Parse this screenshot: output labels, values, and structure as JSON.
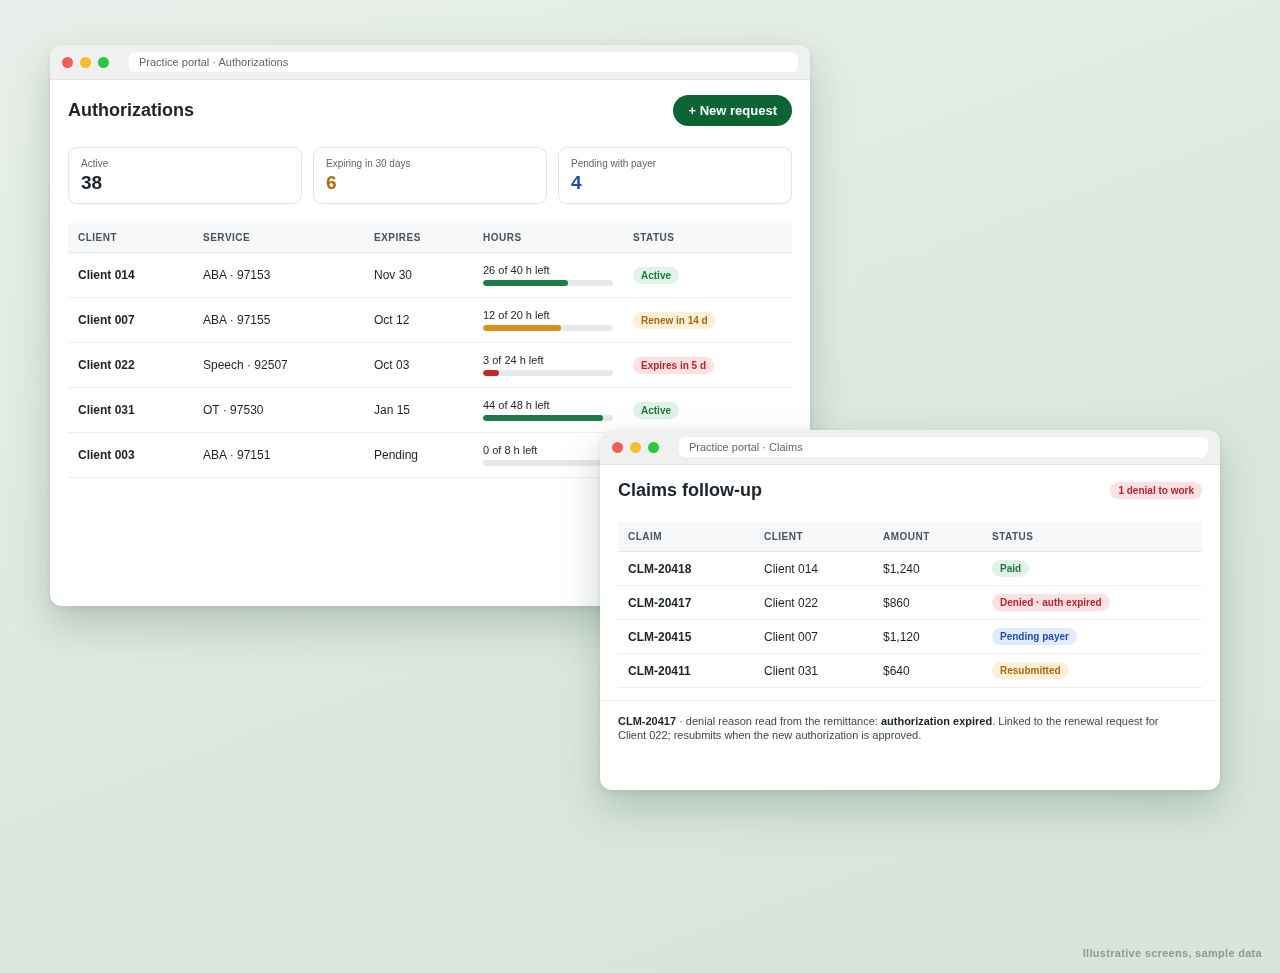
{
  "authorizations_window": {
    "title": "Practice portal · Authorizations",
    "heading": "Authorizations",
    "new_button": "+ New request",
    "stats": [
      {
        "label": "Active",
        "value": "38",
        "color": "#1b232b"
      },
      {
        "label": "Expiring in 30 days",
        "value": "6",
        "color": "#a86c0c"
      },
      {
        "label": "Pending with payer",
        "value": "4",
        "color": "#1f4fae"
      }
    ],
    "table": {
      "columns": [
        "CLIENT",
        "SERVICE",
        "EXPIRES",
        "HOURS",
        "STATUS"
      ],
      "rows": [
        {
          "client": "Client 014",
          "service": "ABA · 97153",
          "expires": "Nov 30",
          "hours": {
            "label": "26 of 40 h left",
            "level": 0.65,
            "kind": "ok"
          },
          "status": {
            "label": "Active",
            "kind": "ok"
          }
        },
        {
          "client": "Client 007",
          "service": "ABA · 97155",
          "expires": "Oct 12",
          "hours": {
            "label": "12 of 20 h left",
            "level": 0.6,
            "kind": "warn"
          },
          "status": {
            "label": "Renew in 14 d",
            "kind": "warn"
          }
        },
        {
          "client": "Client 022",
          "service": "Speech · 92507",
          "expires": "Oct 03",
          "hours": {
            "label": "3 of 24 h left",
            "level": 0.125,
            "kind": "bad"
          },
          "status": {
            "label": "Expires in 5 d",
            "kind": "bad"
          }
        },
        {
          "client": "Client 031",
          "service": "OT · 97530",
          "expires": "Jan 15",
          "hours": {
            "label": "44 of 48 h left",
            "level": 0.92,
            "kind": "ok"
          },
          "status": {
            "label": "Active",
            "kind": "ok"
          }
        },
        {
          "client": "Client 003",
          "service": "ABA · 97151",
          "expires": "Pending",
          "hours": {
            "label": "0 of 8 h left",
            "level": 0,
            "kind": "ok"
          }
        }
      ]
    }
  },
  "claims_window": {
    "title": "Practice portal · Claims",
    "heading": "Claims follow-up",
    "alert_badge": "1 denial to work",
    "table": {
      "columns": [
        "CLAIM",
        "CLIENT",
        "AMOUNT",
        "STATUS"
      ],
      "rows": [
        {
          "claim": "CLM-20418",
          "client": "Client 014",
          "amount": "$1,240",
          "status": {
            "label": "Paid",
            "kind": "ok"
          }
        },
        {
          "claim": "CLM-20417",
          "client": "Client 022",
          "amount": "$860",
          "status": {
            "label": "Denied · auth expired",
            "kind": "bad"
          }
        },
        {
          "claim": "CLM-20415",
          "client": "Client 007",
          "amount": "$1,120",
          "status": {
            "label": "Pending payer",
            "kind": "info"
          }
        },
        {
          "claim": "CLM-20411",
          "client": "Client 031",
          "amount": "$640",
          "status": {
            "label": "Resubmitted",
            "kind": "warn"
          }
        }
      ]
    },
    "note": "**CLM-20417** · denial reason read from the remittance: **authorization expired**. Linked to the renewal request for Client 022; resubmits when the new authorization is approved."
  },
  "caption": "Illustrative screens, sample data"
}
